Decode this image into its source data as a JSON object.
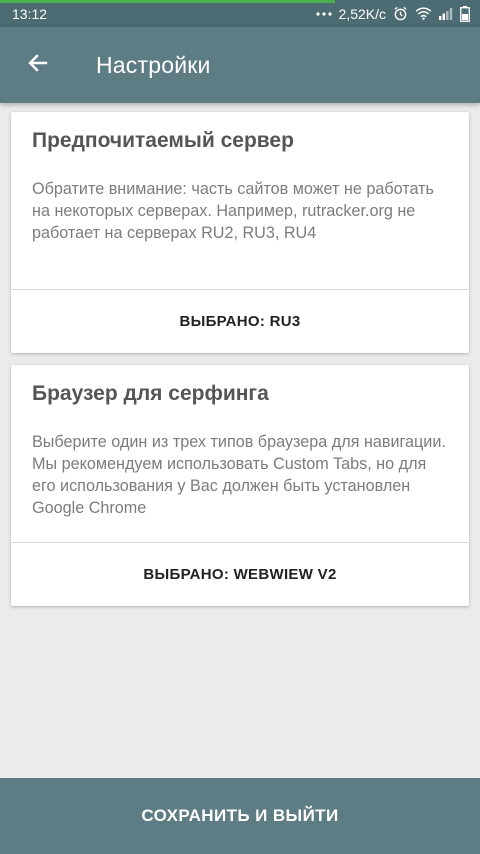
{
  "colors": {
    "status_bar": "#4c6b72",
    "app_bar": "#5d7c84",
    "background": "#ebebeb",
    "card": "#ffffff",
    "progress": "#4caf50"
  },
  "status_bar": {
    "time": "13:12",
    "speed": "2,52K/c",
    "icons": [
      "dots-icon",
      "alarm-icon",
      "wifi-icon",
      "signal-icon",
      "battery-icon"
    ]
  },
  "app_bar": {
    "back_icon": "arrow-left-icon",
    "title": "Настройки"
  },
  "cards": [
    {
      "title": "Предпочитаемый сервер",
      "description": "Обратите внимание: часть сайтов может не работать на некоторых серверах. Например, rutracker.org не работает на серверах RU2, RU3, RU4",
      "action": "ВЫБРАНО: RU3"
    },
    {
      "title": "Браузер для серфинга",
      "description": "Выберите один из трех типов браузера для навигации. Мы рекомендуем использовать Custom Tabs, но для его использования у Вас должен быть установлен Google Chrome",
      "action": "ВЫБРАНО: WEBWIEW V2"
    }
  ],
  "bottom_button": {
    "label": "СОХРАНИТЬ И ВЫЙТИ"
  }
}
